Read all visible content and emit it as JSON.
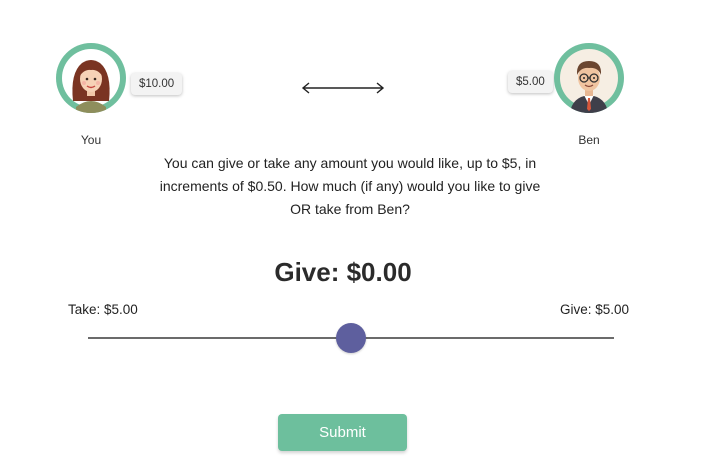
{
  "players": {
    "you": {
      "name": "You",
      "balance": "$10.00",
      "avatar_icon": "woman-avatar-icon"
    },
    "other": {
      "name": "Ben",
      "balance": "$5.00",
      "avatar_icon": "man-avatar-icon"
    }
  },
  "transfer_icon": "double-arrow-icon",
  "prompt": "You can give or take any amount you would like, up to $5, in increments of $0.50. How much (if any) would you like to give OR take from Ben?",
  "current_amount": "Give: $0.00",
  "slider": {
    "min_label": "Take: $5.00",
    "max_label": "Give: $5.00",
    "min": -5,
    "max": 5,
    "step": 0.5,
    "value": 0
  },
  "submit_label": "Submit",
  "colors": {
    "accent_green": "#6dbf9d",
    "slider_thumb": "#5e5f9e",
    "avatar_ring": "#6fbf9e"
  }
}
